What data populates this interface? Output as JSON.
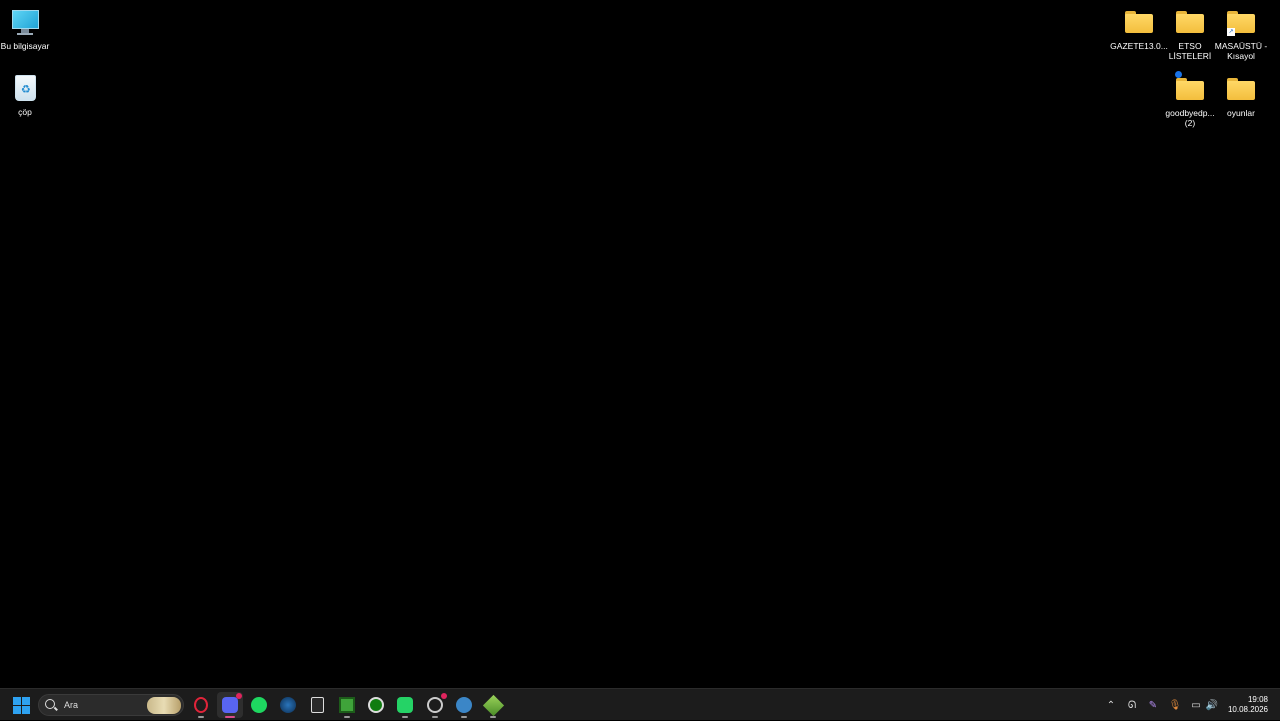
{
  "desktop": {
    "icons_left": [
      {
        "label": "Bu bilgisayar",
        "icon": "computer-icon"
      },
      {
        "label": "çöp",
        "icon": "recycle-bin-icon"
      }
    ],
    "icons_right": [
      {
        "label": "GAZETE13.0...",
        "icon": "folder-icon"
      },
      {
        "label": "ETSO LİSTELERİ",
        "icon": "folder-icon"
      },
      {
        "label": "MASAÜSTÜ - Kısayol",
        "icon": "folder-shortcut-icon"
      },
      {
        "label": "goodbyedp... (2)",
        "icon": "folder-icon"
      },
      {
        "label": "oyunlar",
        "icon": "folder-icon"
      }
    ]
  },
  "taskbar": {
    "search_placeholder": "Ara",
    "pinned_apps": [
      "start-icon",
      "search-box",
      "opera-icon",
      "discord-icon",
      "spotify-icon",
      "steam-icon",
      "epic-games-icon",
      "minecraft-icon",
      "xbox-icon",
      "whatsapp-icon",
      "chrome-like-icon",
      "network-app-icon",
      "minecraft-launcher-icon"
    ],
    "tray": {
      "time": "19:08",
      "date": "10.08.2026"
    }
  },
  "colors": {
    "taskbar_bg": "#1c1c1c",
    "accent": "#2ea2f1",
    "folder": "#ffd866"
  }
}
